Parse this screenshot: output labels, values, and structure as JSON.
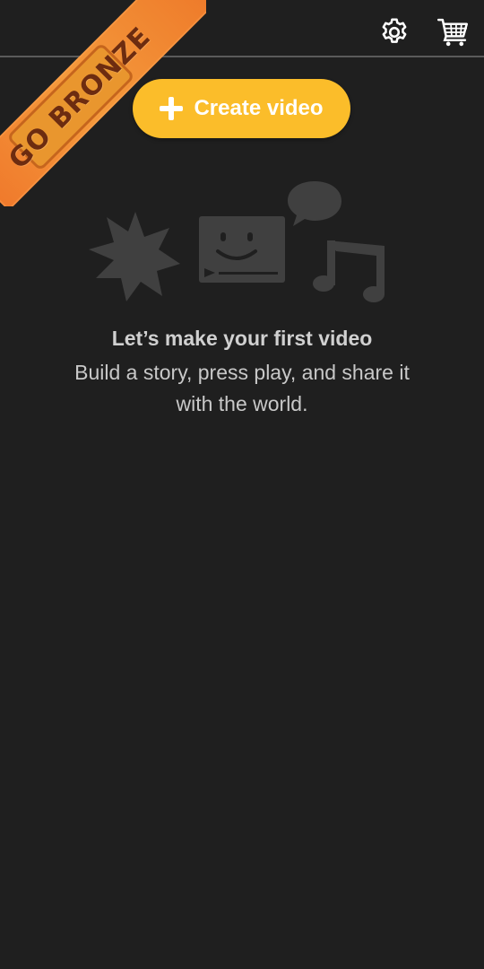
{
  "ribbon": {
    "text": "GO BRONZE"
  },
  "header": {
    "settings_icon": "gear-icon",
    "cart_icon": "cart-icon"
  },
  "create": {
    "label": "Create video"
  },
  "empty_state": {
    "title": "Let’s make your first video",
    "description": "Build a story, press play, and share it with the world."
  },
  "colors": {
    "background": "#1f1f1f",
    "accent": "#fbbd2a",
    "ribbon": "#f07a2c",
    "illustration": "#404040"
  }
}
